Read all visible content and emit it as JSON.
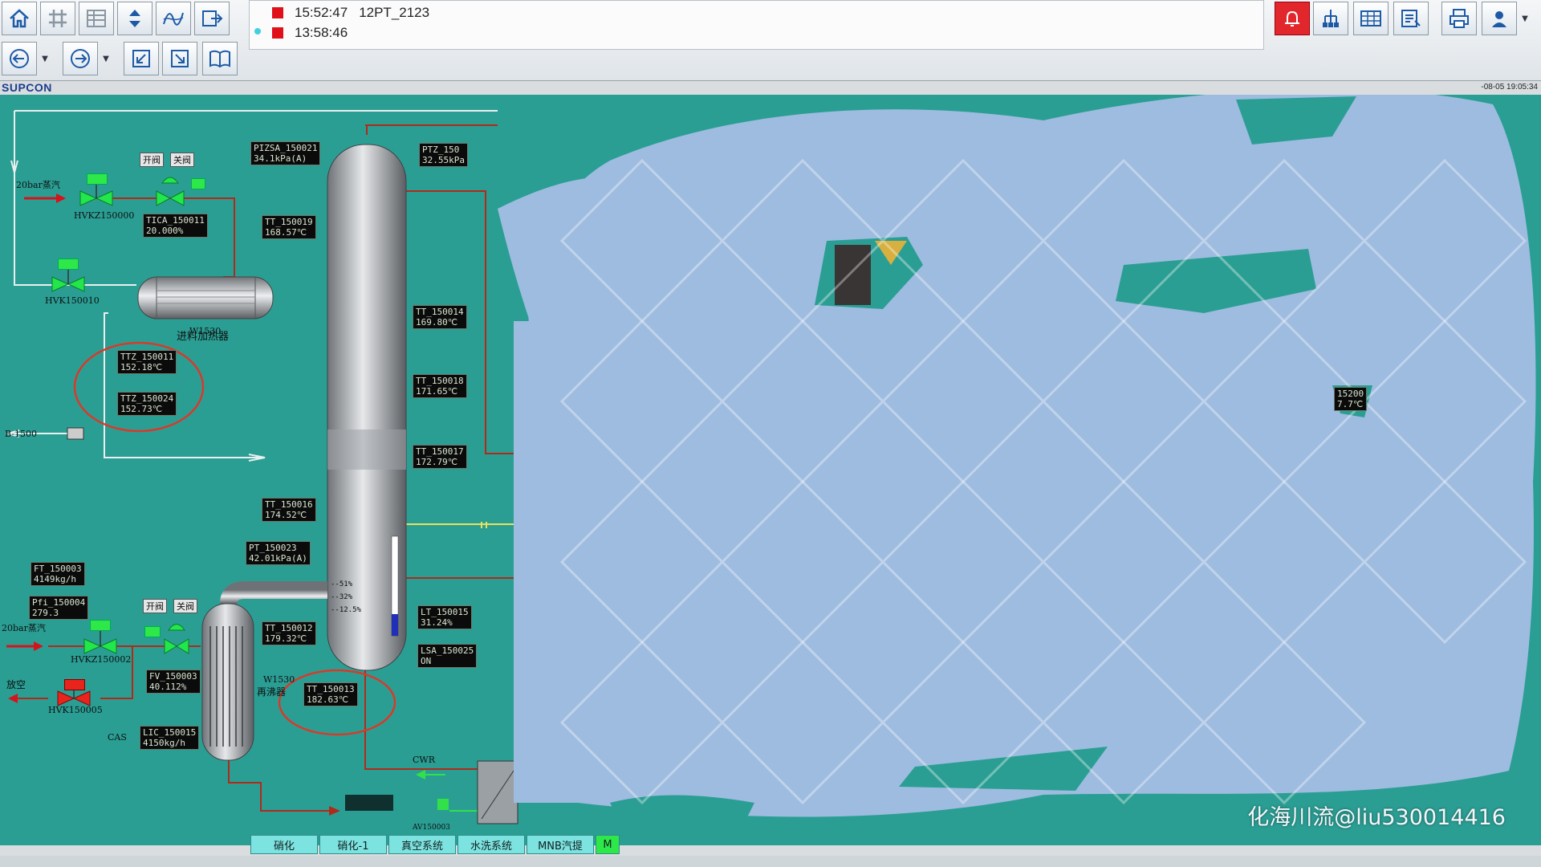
{
  "toolbar": {
    "row1_icons": [
      "home-icon",
      "grid-hash-icon",
      "table-icon",
      "updown-arrows-icon",
      "trend-icon",
      "export-icon"
    ],
    "row2_icons": [
      "back-icon",
      "forward-icon",
      "zoom-in-window-icon",
      "zoom-out-window-icon",
      "book-icon"
    ],
    "right_icons": [
      "alarm-bell-icon",
      "network-icon",
      "table-view-icon",
      "report-icon",
      "print-icon",
      "user-icon"
    ]
  },
  "alarms": [
    {
      "time": "15:52:47",
      "tag": "12PT_2123"
    },
    {
      "time": "13:58:46",
      "tag": ""
    }
  ],
  "brand": "SUPCON",
  "clock": "-08-05 19:05:34",
  "process": {
    "steam_top": "20bar蒸汽",
    "steam_bottom": "20bar蒸汽",
    "vent": "放空",
    "open_label": "开阀",
    "close_label": "关阀",
    "hvkz150000": "HVKZ150000",
    "hvk150010": "HVK150010",
    "hvkz150002": "HVKZ150002",
    "hvk150005": "HVK150005",
    "heater_code": "W1530",
    "heater_name": "进料加热器",
    "reboiler_code": "W1530",
    "reboiler_name": "再沸器",
    "b1500": "B-1500",
    "cas": "CAS",
    "cwr": "CWR",
    "av": "AV150003",
    "tags": {
      "pizsa_150021": "PIZSA_150021",
      "pizsa_150021_val": "34.1kPa(A)",
      "ptz_150": "PTZ_150",
      "ptz_150_val": "32.55kPa",
      "tica_150011": "TICA_150011",
      "tica_150011_val": "20.000%",
      "tt_150019": "TT_150019",
      "tt_150019_val": "168.57℃",
      "tt_150014": "TT_150014",
      "tt_150014_val": "169.80℃",
      "tt_150018": "TT_150018",
      "tt_150018_val": "171.65℃",
      "tt_150017": "TT_150017",
      "tt_150017_val": "172.79℃",
      "ttz_150011": "TTZ_150011",
      "ttz_150011_val": "152.18℃",
      "ttz_150024": "TTZ_150024",
      "ttz_150024_val": "152.73℃",
      "tt_150016": "TT_150016",
      "tt_150016_val": "174.52℃",
      "pt_150023": "PT_150023",
      "pt_150023_val": "42.01kPa(A)",
      "ft_150003": "FT_150003",
      "ft_150003_val": "4149kg/h",
      "pfi_150004": "Pfi_150004",
      "pfi_150004_val": "279.3",
      "tt_150012": "TT_150012",
      "tt_150012_val": "179.32℃",
      "tt_150013": "TT_150013",
      "tt_150013_val": "182.63℃",
      "fv_150003": "FV_150003",
      "fv_150003_val": "40.112%",
      "lic_150015": "LIC_150015",
      "lic_150015_val": "4150kg/h",
      "lt_150015": "LT_150015",
      "lt_150015_val": "31.24%",
      "lsa_150025": "LSA_150025",
      "lsa_150025_val": "ON",
      "r_15200": "15200",
      "r_15200_val": "7.7℃"
    },
    "level_scale": [
      "51%",
      "32%",
      "12.5%"
    ],
    "level_fraction": 0.22
  },
  "bottom_tabs": [
    "硝化",
    "硝化-1",
    "真空系统",
    "水洗系统",
    "MNB汽提",
    "M"
  ],
  "watermark": "化海川流@liu530014416",
  "colors": {
    "background": "#2b9e94",
    "pipe_red": "#b02a1a",
    "steam_arrow": "#d4141c",
    "valve_green": "#2ee84a",
    "tab": "#7de3e0",
    "redaction": "#9ebce0"
  }
}
